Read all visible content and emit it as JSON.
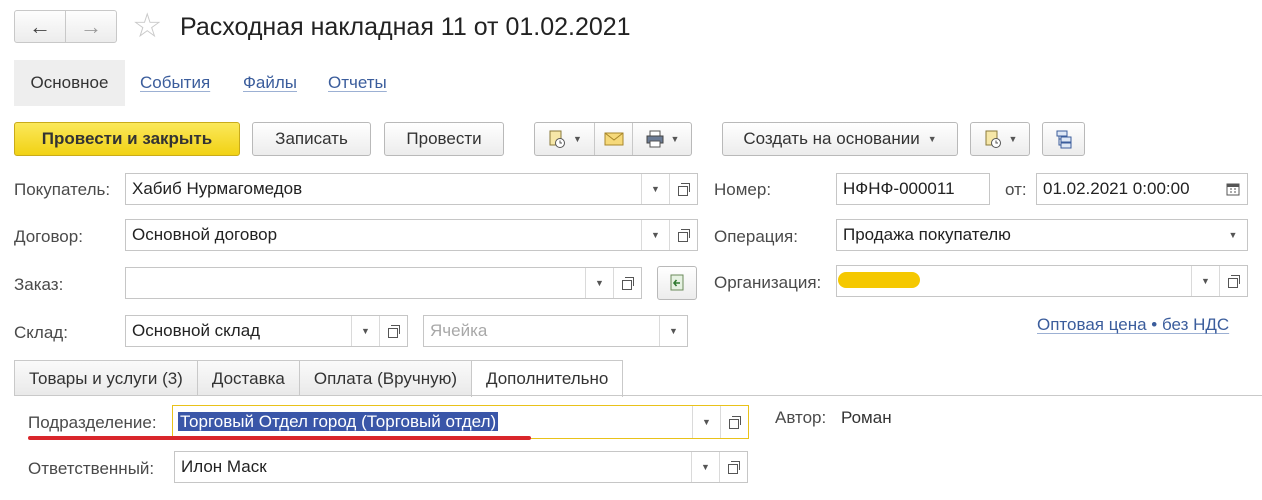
{
  "header": {
    "back_label": "←",
    "forward_label": "→",
    "favorite_label": "☆",
    "title": "Расходная накладная 11  от 01.02.2021"
  },
  "sections": {
    "main": "Основное",
    "events": "События",
    "files": "Файлы",
    "reports": "Отчеты"
  },
  "toolbar": {
    "post_close": "Провести и закрыть",
    "save": "Записать",
    "post": "Провести",
    "create_based": "Создать на основании"
  },
  "form": {
    "buyer_label": "Покупатель:",
    "buyer_value": "Хабиб Нурмагомедов",
    "contract_label": "Договор:",
    "contract_value": "Основной договор",
    "order_label": "Заказ:",
    "order_value": "",
    "warehouse_label": "Склад:",
    "warehouse_value": "Основной склад",
    "cell_placeholder": "Ячейка",
    "number_label": "Номер:",
    "number_value": "НФНФ-000011",
    "date_label": "от:",
    "date_value": "01.02.2021  0:00:00",
    "operation_label": "Операция:",
    "operation_value": "Продажа покупателю",
    "organization_label": "Организация:",
    "price_link": "Оптовая цена • без НДС"
  },
  "tabs": [
    {
      "label": "Товары и услуги (3)"
    },
    {
      "label": "Доставка"
    },
    {
      "label": "Оплата (Вручную)"
    },
    {
      "label": "Дополнительно"
    }
  ],
  "additional": {
    "department_label": "Подразделение:",
    "department_value": "Торговый Отдел город (Торговый отдел)",
    "responsible_label": "Ответственный:",
    "responsible_value": "Илон Маск",
    "author_label": "Автор:",
    "author_value": "Роман"
  },
  "colors": {
    "primary_button": "#f1d214",
    "link": "#3b5d9c",
    "selection": "#3a56a8",
    "annotation_red": "#d9262b",
    "redaction_yellow": "#f5c800"
  }
}
